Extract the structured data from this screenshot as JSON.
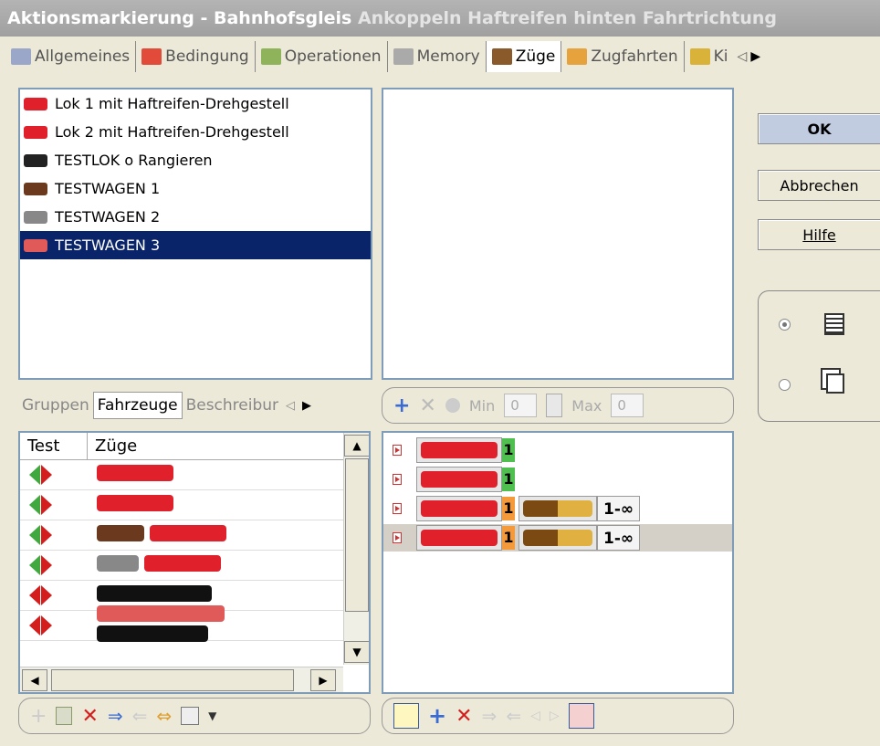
{
  "window": {
    "title": "Aktionsmarkierung - Bahnhofsgleis",
    "subtitle": "Ankoppeln Haftreifen hinten Fahrtrichtung"
  },
  "tabs": [
    {
      "label": "Allgemeines"
    },
    {
      "label": "Bedingung"
    },
    {
      "label": "Operationen"
    },
    {
      "label": "Memory"
    },
    {
      "label": "Züge"
    },
    {
      "label": "Zugfahrten"
    },
    {
      "label": "Ki"
    }
  ],
  "vehicles": [
    {
      "label": "Lok 1 mit Haftreifen-Drehgestell"
    },
    {
      "label": "Lok 2 mit Haftreifen-Drehgestell"
    },
    {
      "label": "TESTLOK o Rangieren"
    },
    {
      "label": "TESTWAGEN 1"
    },
    {
      "label": "TESTWAGEN 2"
    },
    {
      "label": "TESTWAGEN 3"
    }
  ],
  "buttons": {
    "ok": "OK",
    "cancel": "Abbrechen",
    "help": "Hilfe"
  },
  "subtabs": {
    "groups": "Gruppen",
    "vehicles": "Fahrzeuge",
    "description": "Beschreibur"
  },
  "filter": {
    "min_label": "Min",
    "min_value": "0",
    "max_label": "Max",
    "max_value": "0"
  },
  "trains_grid": {
    "col_test": "Test",
    "col_trains": "Züge"
  },
  "sequence": [
    {
      "count": "1"
    },
    {
      "count": "1"
    },
    {
      "count": "1",
      "range": "1-∞"
    },
    {
      "count": "1",
      "range": "1-∞"
    }
  ]
}
